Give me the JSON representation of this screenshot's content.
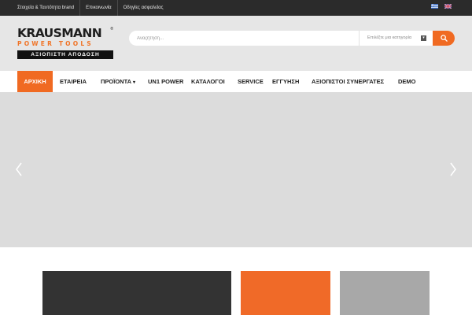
{
  "topbar": {
    "links": [
      {
        "label": "Στοιχεία & Ταυτότητα brand"
      },
      {
        "label": "Επικοινωνία"
      },
      {
        "label": "Οδηγίες ασφαλείας"
      }
    ],
    "flags": [
      "greek-flag-icon",
      "uk-flag-icon"
    ]
  },
  "logo": {
    "brand": "KRAUSMANN",
    "subtitle": "POWER TOOLS",
    "tagline": "ΑΞΙΟΠΙΣΤΗ ΑΠΟΔΟΣΗ"
  },
  "search": {
    "placeholder": "Αναζήτηση...",
    "category_value": "Επιλέξτε μια κατηγορία",
    "button_icon": "search-icon"
  },
  "nav": {
    "items": [
      {
        "label": "ΑΡΧΙΚΗ"
      },
      {
        "label": "ΕΤΑΙΡΕΙΑ"
      },
      {
        "label": "ΠΡΟΪΟΝΤΑ"
      },
      {
        "label": "UN1 POWER"
      },
      {
        "label": "ΚΑΤΑΛΟΓΟΙ"
      },
      {
        "label": "SERVICE"
      },
      {
        "label": "ΕΓΓΥΗΣΗ"
      },
      {
        "label": "ΑΞΙΟΠΙΣΤΟΙ ΣΥΝΕΡΓΑΤΕΣ"
      },
      {
        "label": "DEMO"
      }
    ]
  },
  "slider": {
    "prev_icon": "chevron-left-icon",
    "next_icon": "chevron-right-icon"
  },
  "colors": {
    "accent": "#f06a22",
    "topbar": "#2b2b2b",
    "header": "#e6e6e6",
    "slider": "#dcdcdc"
  }
}
